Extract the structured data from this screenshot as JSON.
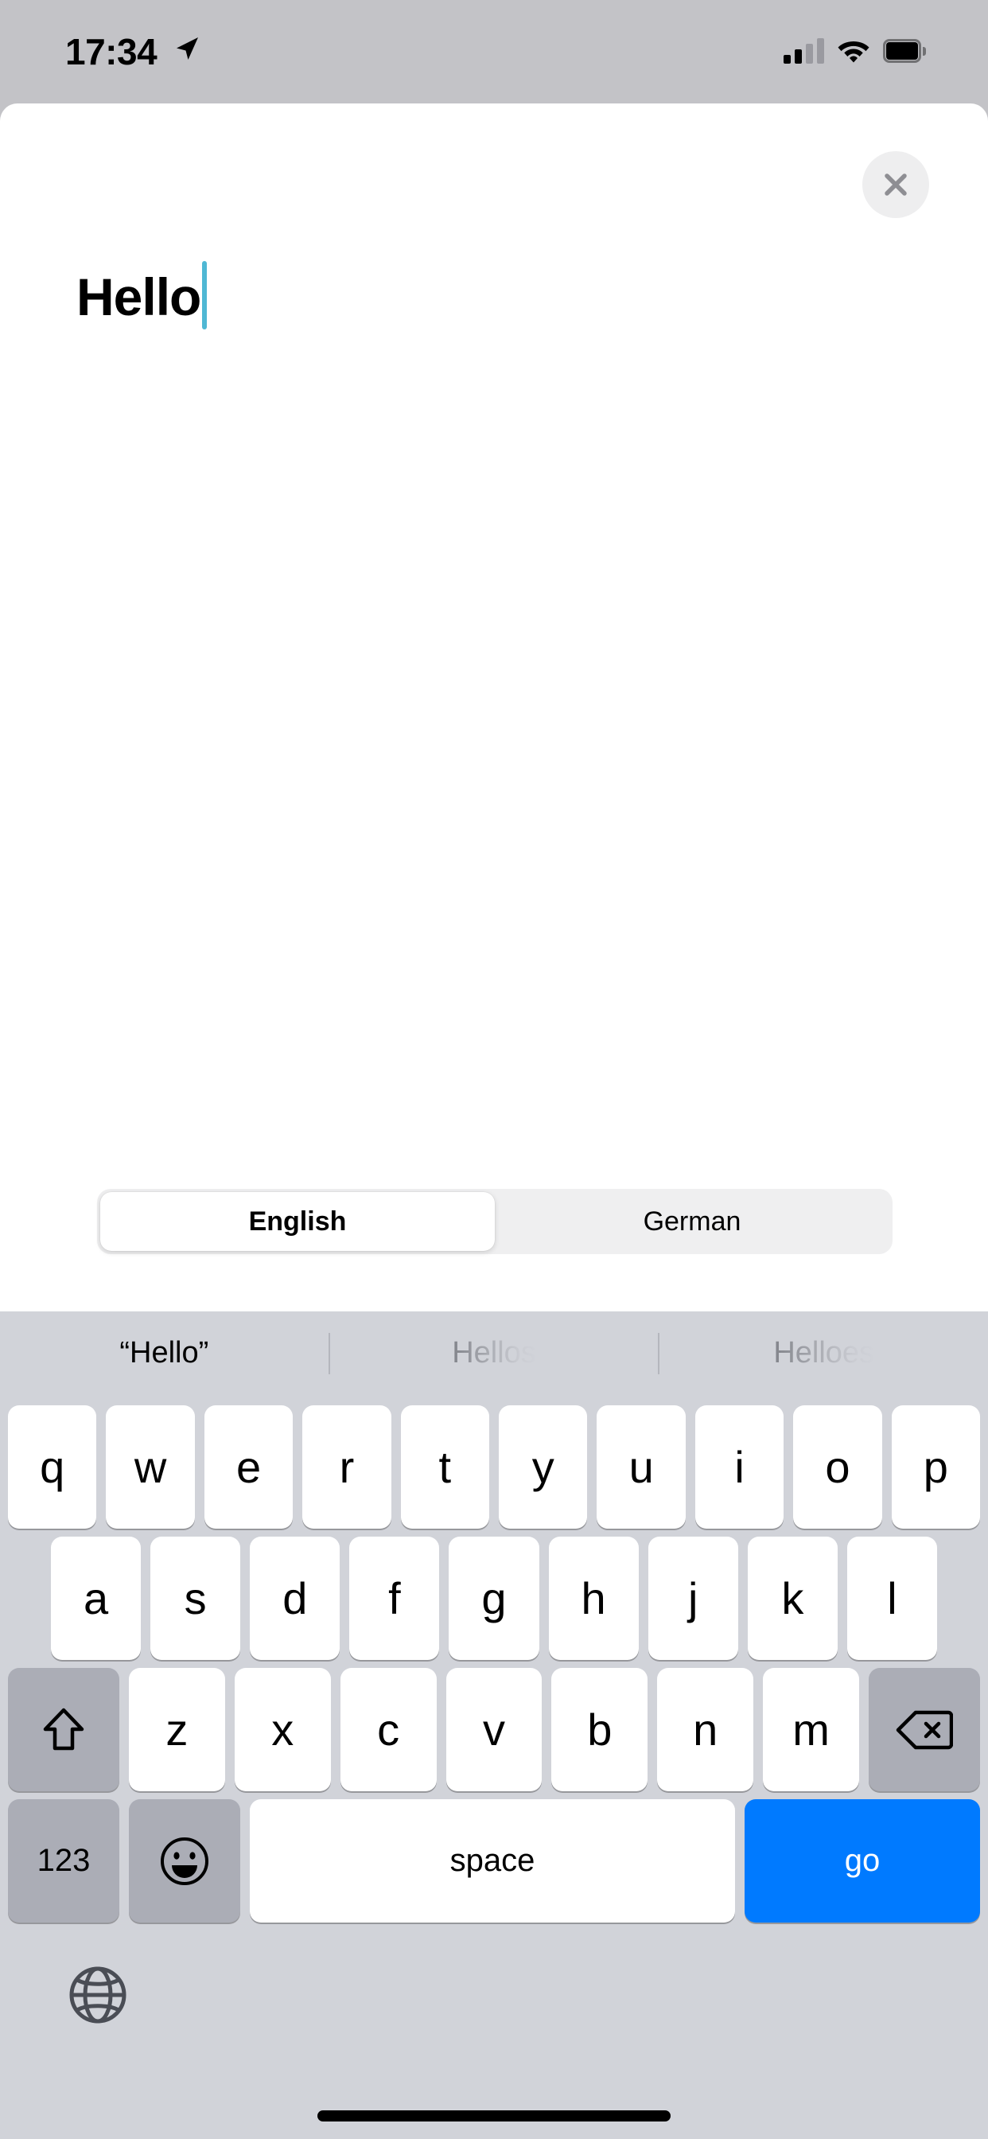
{
  "status_bar": {
    "time": "17:34",
    "location_icon": "location-arrow-icon",
    "cellular_icon": "cellular-signal-icon",
    "cellular_bars_filled": 2,
    "cellular_bars_total": 4,
    "wifi_icon": "wifi-icon",
    "battery_icon": "battery-full-icon",
    "background_color": "#c3c3c7"
  },
  "sheet": {
    "close_icon": "close-icon",
    "close_button_bg": "#eeeeef",
    "close_icon_color": "#8e8e93",
    "text_field": {
      "value": "Hello",
      "caret_color": "#4fb8d4"
    },
    "language_segment": {
      "options": [
        {
          "label": "English",
          "selected": true
        },
        {
          "label": "German",
          "selected": false
        }
      ],
      "track_color": "#efeff0"
    }
  },
  "keyboard": {
    "background_color": "#d1d3d9",
    "predictions": [
      {
        "text": "“Hello”",
        "faded": false
      },
      {
        "text": "Hellos",
        "faded": true
      },
      {
        "text": "Helloes",
        "faded": true
      }
    ],
    "row_1": [
      "q",
      "w",
      "e",
      "r",
      "t",
      "y",
      "u",
      "i",
      "o",
      "p"
    ],
    "row_2": [
      "a",
      "s",
      "d",
      "f",
      "g",
      "h",
      "j",
      "k",
      "l"
    ],
    "row_3_letters": [
      "z",
      "x",
      "c",
      "v",
      "b",
      "n",
      "m"
    ],
    "shift_icon": "shift-icon",
    "backspace_icon": "backspace-icon",
    "numbers_key_label": "123",
    "emoji_icon": "emoji-smiley-icon",
    "space_key_label": "space",
    "return_key_label": "go",
    "return_key_color": "#007aff",
    "globe_icon": "globe-icon",
    "globe_icon_color": "#4a4d55",
    "key_color": "#ffffff",
    "function_key_color": "#abadb6"
  }
}
